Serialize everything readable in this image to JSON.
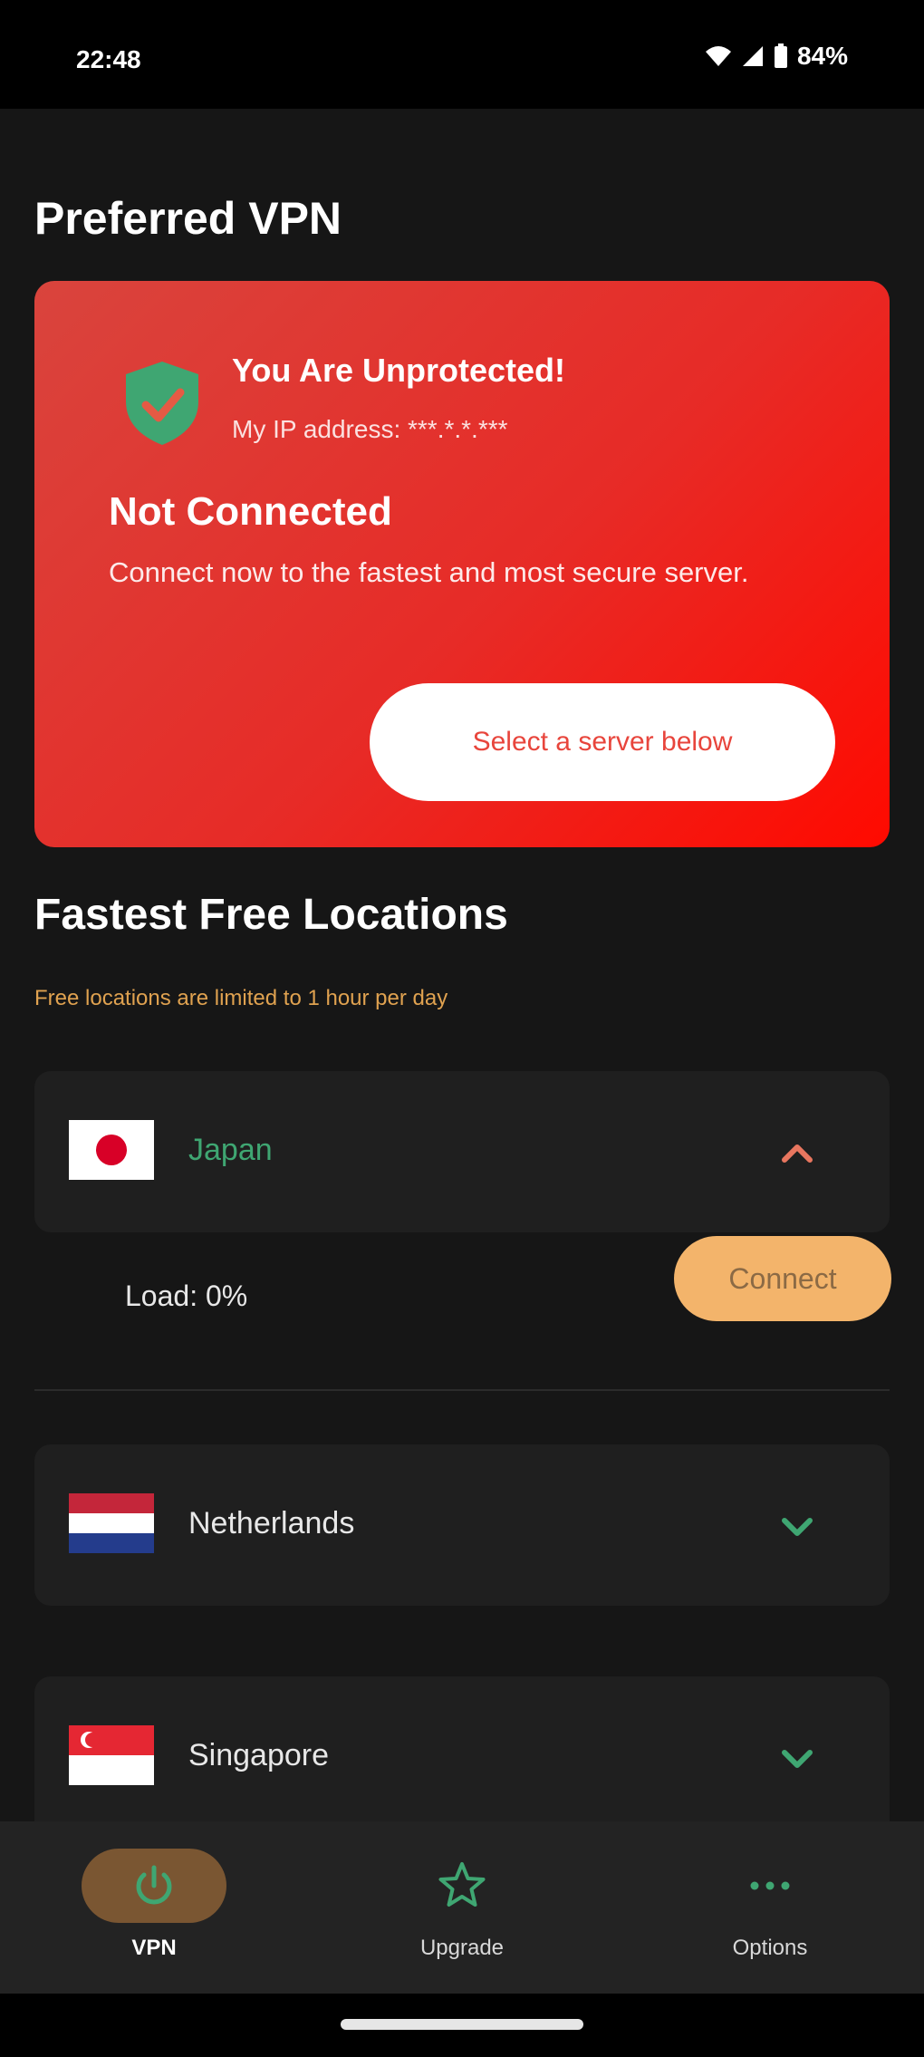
{
  "status_bar": {
    "time": "22:48",
    "battery": "84%"
  },
  "page": {
    "title": "Preferred VPN"
  },
  "hero": {
    "heading": "You Are Unprotected!",
    "ip_text": "My IP address: ***.*.*.***",
    "status": "Not Connected",
    "description": "Connect now to the fastest and most secure server.",
    "button_label": "Select a server below",
    "gradient_colors": [
      "#d9443d",
      "#e72b27",
      "#ff0a00"
    ],
    "shield_color": "#3fa672"
  },
  "locations_section": {
    "title": "Fastest Free Locations",
    "note": "Free locations are limited to 1 hour per day"
  },
  "locations": [
    {
      "name": "Japan",
      "flag": "japan-flag",
      "expanded": true,
      "name_color": "#3fa672",
      "chevron_color": "#e8765f"
    },
    {
      "name": "Netherlands",
      "flag": "netherlands-flag",
      "expanded": false,
      "name_color": "#e8e8e8",
      "chevron_color": "#3fa672"
    },
    {
      "name": "Singapore",
      "flag": "singapore-flag",
      "expanded": false,
      "name_color": "#e8e8e8",
      "chevron_color": "#3fa672"
    }
  ],
  "expanded_location": {
    "load_label": "Load: 0%",
    "connect_label": "Connect"
  },
  "bottom_nav": {
    "items": [
      {
        "label": "VPN",
        "icon": "power-icon",
        "active": true
      },
      {
        "label": "Upgrade",
        "icon": "star-icon",
        "active": false
      },
      {
        "label": "Options",
        "icon": "more-dots-icon",
        "active": false
      }
    ]
  },
  "colors": {
    "background": "#161616",
    "card": "#1f1f1f",
    "accent_orange": "#f3b46b",
    "accent_green": "#3fa672"
  }
}
